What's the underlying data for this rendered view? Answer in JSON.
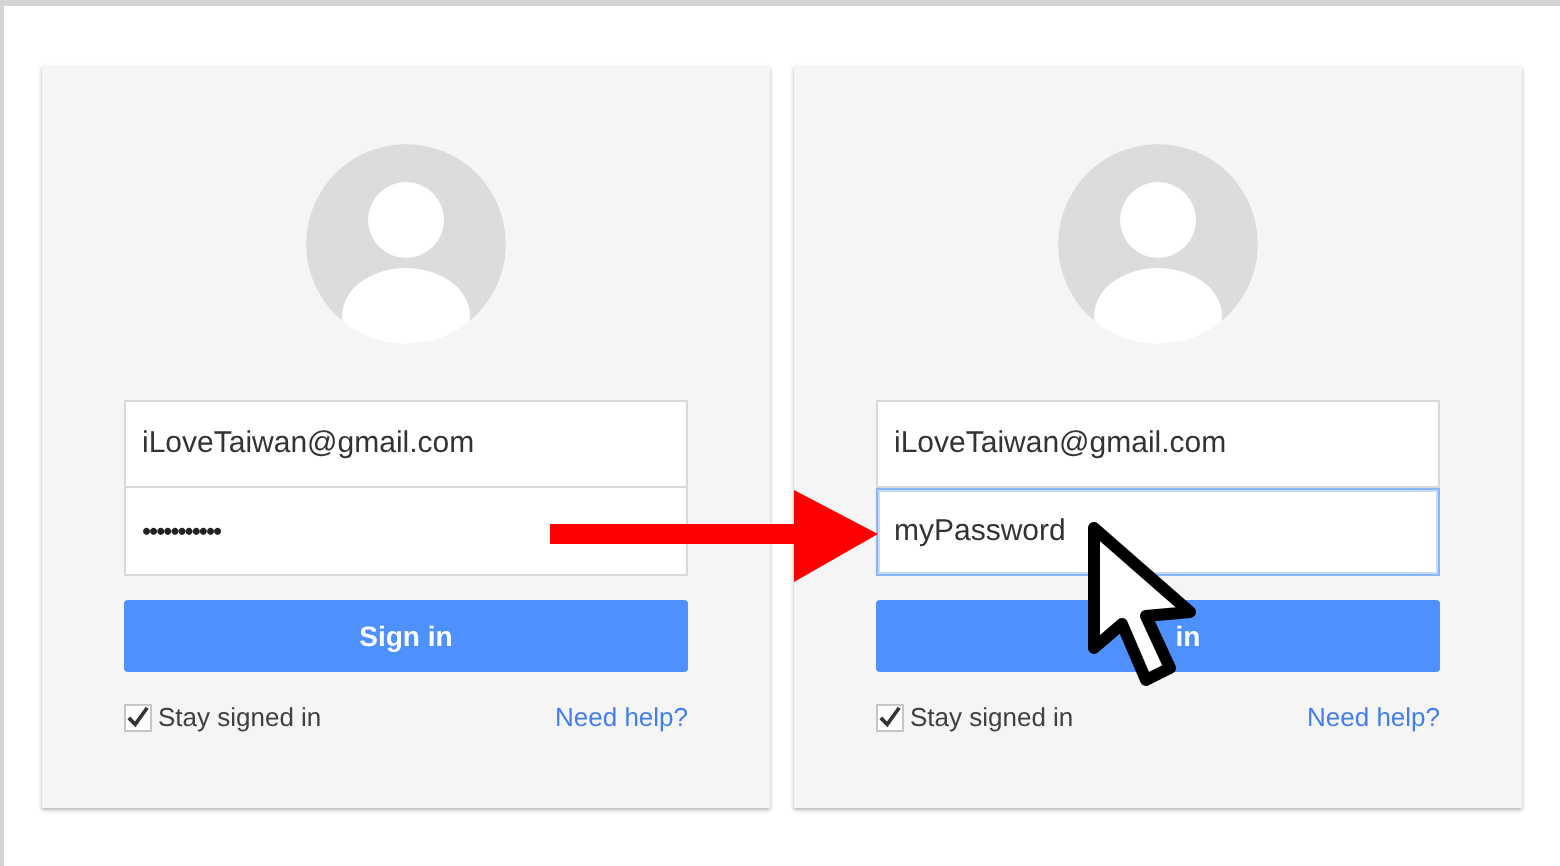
{
  "cards": [
    {
      "email": "iLoveTaiwan@gmail.com",
      "password": "•••••••••••",
      "password_focused": false,
      "button": "Sign in",
      "stay_signed_in": {
        "label": "Stay signed in",
        "checked": true
      },
      "help_link": "Need help?"
    },
    {
      "email": "iLoveTaiwan@gmail.com",
      "password": "myPassword",
      "password_focused": true,
      "button": "in",
      "stay_signed_in": {
        "label": "Stay signed in",
        "checked": true
      },
      "help_link": "Need help?"
    }
  ]
}
